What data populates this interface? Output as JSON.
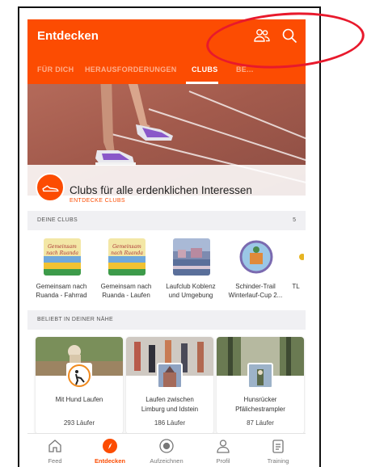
{
  "header": {
    "title": "Entdecken",
    "people_icon": "people-icon",
    "search_icon": "search-icon"
  },
  "tabs": [
    {
      "label": "FÜR DICH",
      "active": false
    },
    {
      "label": "HERAUSFORDERUNGEN",
      "active": false
    },
    {
      "label": "CLUBS",
      "active": true
    },
    {
      "label": "BE...",
      "active": false
    }
  ],
  "hero": {
    "title": "Clubs für alle erdenklichen Interessen",
    "subtitle": "ENTDECKE CLUBS",
    "badge_icon": "shoe-icon"
  },
  "my_clubs": {
    "label": "DEINE CLUBS",
    "count": "5",
    "items": [
      {
        "line1": "Gemeinsam nach",
        "line2": "Ruanda - Fahrrad"
      },
      {
        "line1": "Gemeinsam nach",
        "line2": "Ruanda - Laufen"
      },
      {
        "line1": "Laufclub Koblenz",
        "line2": "und Umgebung"
      },
      {
        "line1": "Schinder-Trail",
        "line2": "Winterlauf-Cup 2..."
      },
      {
        "line1": "TL",
        "line2": ""
      }
    ]
  },
  "nearby": {
    "label": "BELIEBT IN DEINER NÄHE",
    "cards": [
      {
        "title": "Mit Hund Laufen",
        "title2": "",
        "count": "293 Läufer"
      },
      {
        "title": "Laufen zwischen",
        "title2": "Limburg und Idstein",
        "count": "186 Läufer"
      },
      {
        "title": "Hunsrücker",
        "title2": "Pfälichestrampler",
        "count": "87 Läufer"
      }
    ]
  },
  "bottom_nav": [
    {
      "label": "Feed",
      "icon": "home-icon",
      "active": false
    },
    {
      "label": "Entdecken",
      "icon": "compass-icon",
      "active": true
    },
    {
      "label": "Aufzeichnen",
      "icon": "record-icon",
      "active": false
    },
    {
      "label": "Profil",
      "icon": "profile-icon",
      "active": false
    },
    {
      "label": "Training",
      "icon": "training-icon",
      "active": false
    }
  ],
  "colors": {
    "accent": "#fc4c02",
    "annotation": "#e8192c"
  }
}
